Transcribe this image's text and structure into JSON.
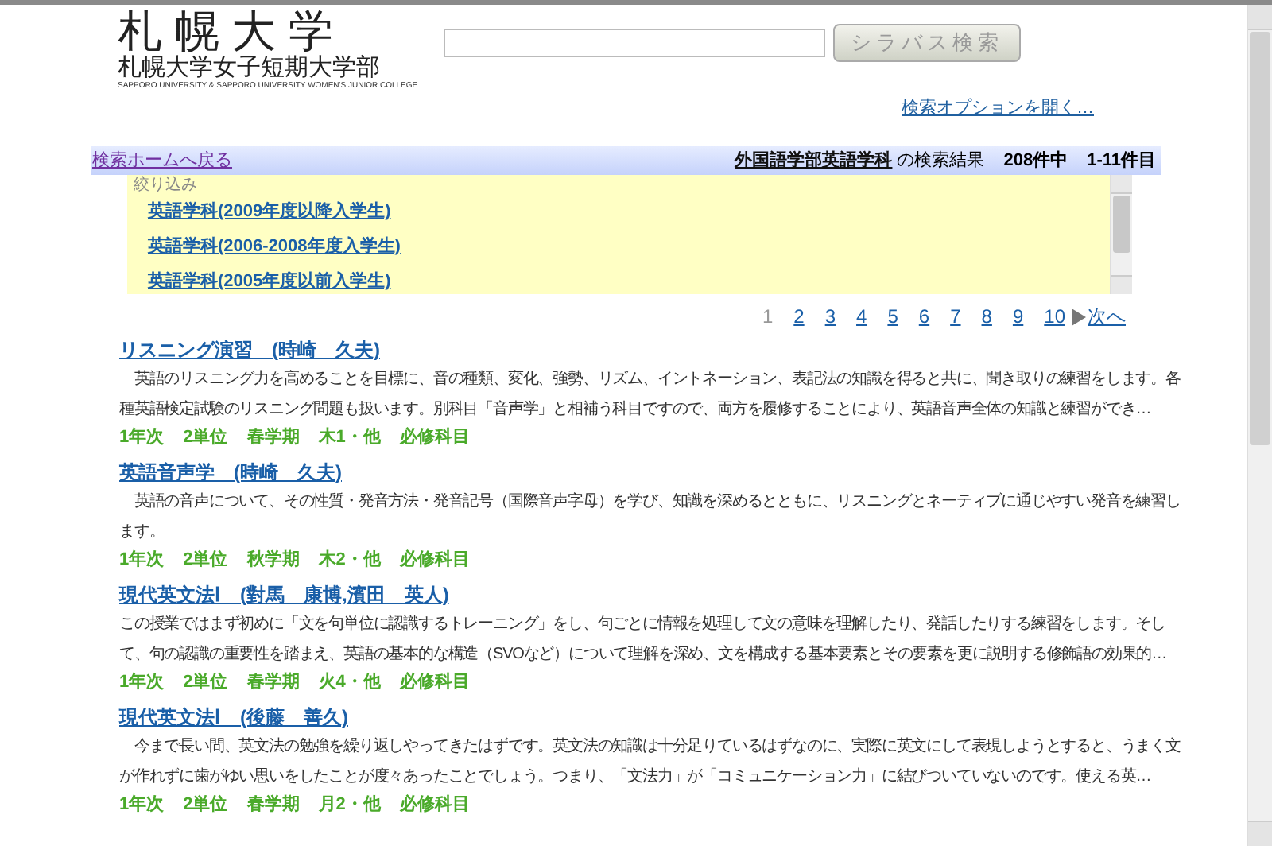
{
  "logo": {
    "title": "札 幌 大 学",
    "subtitle": "札幌大学女子短期大学部",
    "english": "SAPPORO UNIVERSITY & SAPPORO UNIVERSITY WOMEN'S JUNIOR COLLEGE"
  },
  "search": {
    "button": "シラバス検索",
    "options_link": "検索オプションを開く…"
  },
  "result_bar": {
    "back_link": "検索ホームへ戻る",
    "department": "外国語学部英語学科",
    "suffix": "の検索結果",
    "total": "208件中",
    "range": "1-11件目"
  },
  "refine": {
    "label": "絞り込み",
    "items": [
      "英語学科(2009年度以降入学生)",
      "英語学科(2006-2008年度入学生)",
      "英語学科(2005年度以前入学生)"
    ]
  },
  "pagination": {
    "pages": [
      {
        "label": "1",
        "selected": true
      },
      {
        "label": "2",
        "selected": false
      },
      {
        "label": "3",
        "selected": false
      },
      {
        "label": "4",
        "selected": false
      },
      {
        "label": "5",
        "selected": false
      },
      {
        "label": "6",
        "selected": false
      },
      {
        "label": "7",
        "selected": false
      },
      {
        "label": "8",
        "selected": false
      },
      {
        "label": "9",
        "selected": false
      },
      {
        "label": "10",
        "selected": false
      }
    ],
    "next": "次へ"
  },
  "results": [
    {
      "title": "リスニング演習　(時崎　久夫)",
      "description": "　英語のリスニング力を高めることを目標に、音の種類、変化、強勢、リズム、イントネーション、表記法の知識を得ると共に、聞き取りの練習をします。各種英語検定試験のリスニング問題も扱います。別科目「音声学」と相補う科目ですので、両方を履修することにより、英語音声全体の知識と練習ができ…",
      "meta": [
        "1年次",
        "2単位",
        "春学期",
        "木1・他",
        "必修科目"
      ]
    },
    {
      "title": "英語音声学　(時崎　久夫)",
      "description": "　英語の音声について、その性質・発音方法・発音記号（国際音声字母）を学び、知識を深めるとともに、リスニングとネーティブに通じやすい発音を練習します。",
      "meta": [
        "1年次",
        "2単位",
        "秋学期",
        "木2・他",
        "必修科目"
      ]
    },
    {
      "title": "現代英文法Ⅰ　(對馬　康博,濱田　英人)",
      "description": "この授業ではまず初めに「文を句単位に認識するトレーニング」をし、句ごとに情報を処理して文の意味を理解したり、発話したりする練習をします。そして、句の認識の重要性を踏まえ、英語の基本的な構造（SVOなど）について理解を深め、文を構成する基本要素とその要素を更に説明する修飾語の効果的…",
      "meta": [
        "1年次",
        "2単位",
        "春学期",
        "火4・他",
        "必修科目"
      ]
    },
    {
      "title": "現代英文法Ⅰ　(後藤　善久)",
      "description": "　今まで長い間、英文法の勉強を繰り返しやってきたはずです。英文法の知識は十分足りているはずなのに、実際に英文にして表現しようとすると、うまく文が作れずに歯がゆい思いをしたことが度々あったことでしょう。つまり、「文法力」が「コミュニケーション力」に結びついていないのです。使える英…",
      "meta": [
        "1年次",
        "2単位",
        "春学期",
        "月2・他",
        "必修科目"
      ]
    }
  ]
}
